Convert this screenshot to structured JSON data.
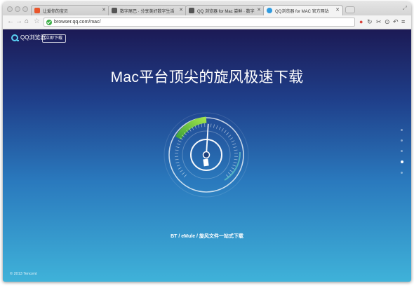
{
  "browser": {
    "tabs": [
      {
        "title": "让爱你的宝贝",
        "active": false,
        "favicon_color": "#e8552b"
      },
      {
        "title": "数字尾巴 · 分享美好数字生活",
        "active": false,
        "favicon_color": "#555555"
      },
      {
        "title": "QQ 浏览器 for Mac 尝鲜 · 数字尾巴 大航天 · 数...",
        "active": false,
        "favicon_color": "#555555"
      },
      {
        "title": "QQ浏览器 for MAC 官方网站",
        "active": true,
        "favicon_color": "#2f9be0"
      }
    ],
    "url": "browser.qq.com/mac/"
  },
  "site": {
    "logo_text": "QQ浏览器",
    "header_download_label": "立即下载",
    "headline": "Mac平台顶尖的旋风极速下载",
    "subline": "BT / eMule / 旋风文件一站式下载",
    "footer": "© 2013 Tencent",
    "page_indicators": 5,
    "active_indicator": 3
  },
  "colors": {
    "gauge_green": "#7ad43d",
    "logo_accent": "#5ad0f2"
  }
}
